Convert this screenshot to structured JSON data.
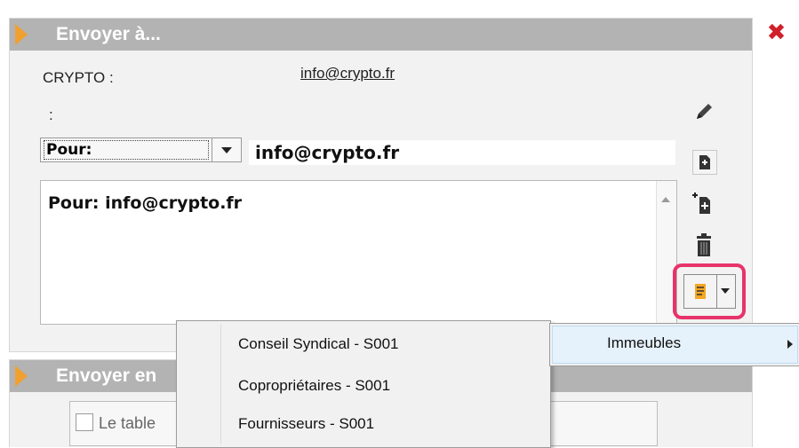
{
  "send_to": {
    "title": "Envoyer à...",
    "contact_label": "CRYPTO :",
    "contact_email": "info@crypto.fr",
    "second_label": ":",
    "recipient_type": "Pour:",
    "recipient_value": "info@crypto.fr",
    "recipients_text": "Pour: info@crypto.fr"
  },
  "section2": {
    "title": "Envoyer en",
    "checkbox_label": "Le table"
  },
  "context_menu": {
    "items": [
      {
        "label": "Conseil Syndical - S001"
      },
      {
        "label": "Copropriétaires - S001"
      },
      {
        "label": "Fournisseurs - S001"
      }
    ],
    "submenu_label": "Immeubles"
  },
  "colors": {
    "header": "#b3b3b3",
    "accent_triangle": "#f0a030",
    "highlight": "#e8336a",
    "close": "#d0202a"
  },
  "icons": [
    "pencil-icon",
    "add-document-icon",
    "add-multiple-icon",
    "trash-icon",
    "list-icon",
    "close-icon"
  ]
}
